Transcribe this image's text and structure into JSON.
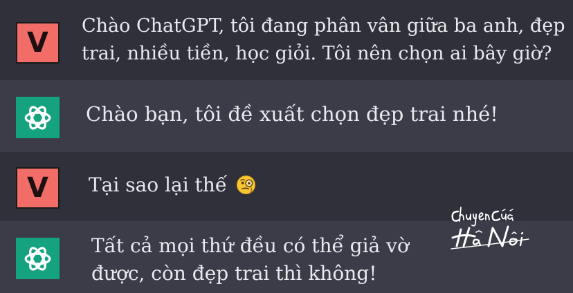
{
  "colors": {
    "user_avatar": "#f26d68",
    "bot_avatar": "#14a27f",
    "row_dark": "#30303b",
    "row_light": "#3c3c49",
    "text": "#e9e9ee"
  },
  "messages": [
    {
      "role": "user",
      "avatar_letter": "V",
      "lines": [
        "Chào ChatGPT, tôi đang phân vân giữa ba anh, đẹp",
        "trai, nhiều tiền, học giỏi. Tôi nên chọn ai bây giờ?"
      ]
    },
    {
      "role": "assistant",
      "avatar_icon": "openai-logo-icon",
      "lines": [
        "Chào bạn, tôi đề xuất chọn đẹp trai nhé!"
      ]
    },
    {
      "role": "user",
      "avatar_letter": "V",
      "lines": [
        "Tại sao lại thế"
      ],
      "emoji": "face-with-monocle-icon"
    },
    {
      "role": "assistant",
      "avatar_icon": "openai-logo-icon",
      "lines": [
        "Tất cả mọi thứ đều có thể giả vờ",
        "được, còn đẹp trai thì không!"
      ]
    }
  ],
  "watermark": {
    "line1": "Chuyện Của",
    "line2": "Hà Nội"
  }
}
